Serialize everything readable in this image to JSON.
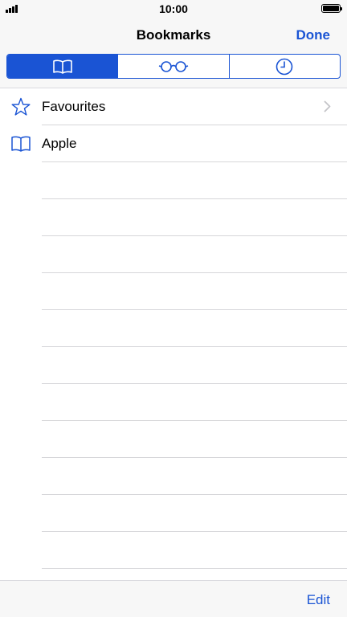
{
  "status_bar": {
    "time": "10:00"
  },
  "nav": {
    "title": "Bookmarks",
    "done_label": "Done"
  },
  "segmented": {
    "segments": [
      {
        "icon": "book-icon",
        "selected": true
      },
      {
        "icon": "glasses-icon",
        "selected": false
      },
      {
        "icon": "clock-icon",
        "selected": false
      }
    ]
  },
  "list": {
    "items": [
      {
        "label": "Favourites",
        "icon": "star-icon",
        "has_chevron": true
      },
      {
        "label": "Apple",
        "icon": "book-icon",
        "has_chevron": false
      }
    ]
  },
  "toolbar": {
    "edit_label": "Edit"
  },
  "colors": {
    "accent": "#1a54d4",
    "bar_background": "#f7f7f7",
    "separator": "#d6d6d9"
  }
}
